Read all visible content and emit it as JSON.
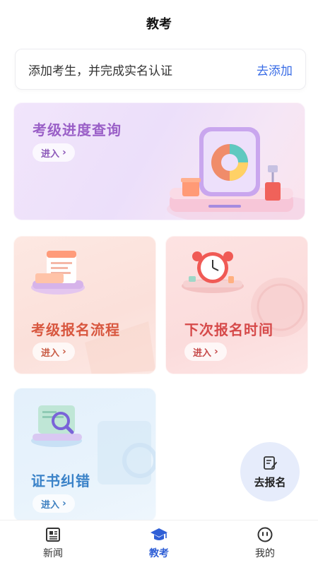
{
  "header": {
    "title": "教考"
  },
  "notice": {
    "text": "添加考生，并完成实名认证",
    "action": "去添加"
  },
  "cards": {
    "progress": {
      "title": "考级进度查询",
      "enter": "进入"
    },
    "signup": {
      "title": "考级报名流程",
      "enter": "进入"
    },
    "time": {
      "title": "下次报名时间",
      "enter": "进入"
    },
    "cert": {
      "title": "证书纠错",
      "enter": "进入"
    }
  },
  "float_button": {
    "label": "去报名",
    "icon": "edit-form-icon"
  },
  "tabbar": {
    "tabs": [
      {
        "label": "新闻",
        "icon": "news-icon"
      },
      {
        "label": "教考",
        "icon": "graduation-cap-icon",
        "active": true
      },
      {
        "label": "我的",
        "icon": "smiley-face-icon"
      }
    ]
  },
  "colors": {
    "accent": "#2f5fd6",
    "link": "#3a6de6"
  }
}
